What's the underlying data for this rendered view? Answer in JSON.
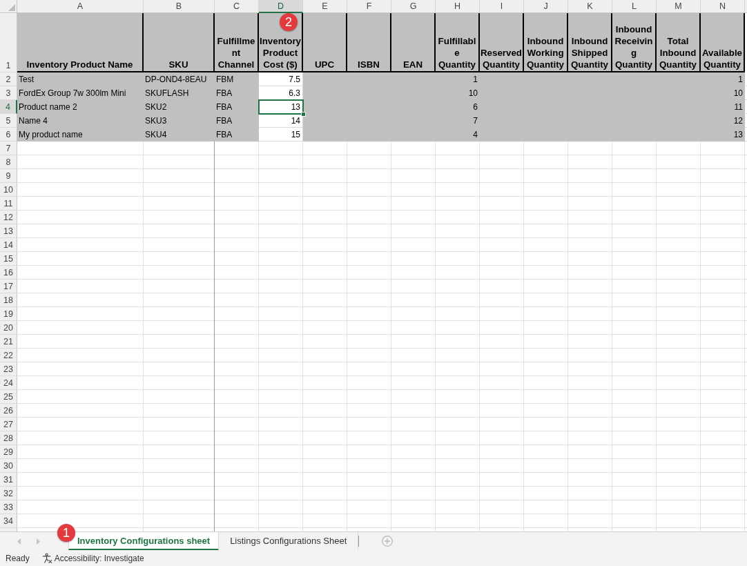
{
  "sheet": {
    "columns": [
      {
        "letter": "A",
        "selected": false
      },
      {
        "letter": "B",
        "selected": false
      },
      {
        "letter": "C",
        "selected": false
      },
      {
        "letter": "D",
        "selected": true,
        "callout": "2"
      },
      {
        "letter": "E",
        "selected": false
      },
      {
        "letter": "F",
        "selected": false
      },
      {
        "letter": "G",
        "selected": false
      },
      {
        "letter": "H",
        "selected": false
      },
      {
        "letter": "I",
        "selected": false
      },
      {
        "letter": "J",
        "selected": false
      },
      {
        "letter": "K",
        "selected": false
      },
      {
        "letter": "L",
        "selected": false
      },
      {
        "letter": "M",
        "selected": false
      },
      {
        "letter": "N",
        "selected": false
      }
    ],
    "rows": [
      {
        "number": "1",
        "selected": false,
        "cells": [
          {
            "kind": "heading",
            "value": "Inventory Product Name",
            "shaded": true
          },
          {
            "kind": "heading",
            "value": "SKU",
            "shaded": true
          },
          {
            "kind": "heading",
            "value": "Fulfillment Channel",
            "shaded": true
          },
          {
            "kind": "heading",
            "value": "Inventory Product Cost ($)",
            "shaded": true
          },
          {
            "kind": "heading",
            "value": "UPC",
            "shaded": true
          },
          {
            "kind": "heading",
            "value": "ISBN",
            "shaded": true
          },
          {
            "kind": "heading",
            "value": "EAN",
            "shaded": true
          },
          {
            "kind": "heading",
            "value": "Fulfillable Quantity",
            "shaded": true
          },
          {
            "kind": "heading",
            "value": "Reserved Quantity",
            "shaded": true
          },
          {
            "kind": "heading",
            "value": "Inbound Working Quantity",
            "shaded": true
          },
          {
            "kind": "heading",
            "value": "Inbound Shipped Quantity",
            "shaded": true
          },
          {
            "kind": "heading",
            "value": "Inbound Receiving Quantity",
            "shaded": true
          },
          {
            "kind": "heading",
            "value": "Total Inbound Quantity",
            "shaded": true
          },
          {
            "kind": "heading",
            "value": "Available Quantity",
            "shaded": true
          }
        ]
      },
      {
        "number": "2",
        "selected": false,
        "cells": [
          {
            "kind": "text",
            "value": "Test",
            "shaded": true
          },
          {
            "kind": "text",
            "value": "DP-OND4-8EAU",
            "shaded": true
          },
          {
            "kind": "text",
            "value": "FBM",
            "shaded": true
          },
          {
            "kind": "number",
            "value": "7.5",
            "shaded": false
          },
          null,
          null,
          null,
          {
            "kind": "number",
            "value": "1",
            "shaded": true
          },
          null,
          null,
          null,
          null,
          null,
          {
            "kind": "number",
            "value": "1",
            "shaded": true
          }
        ]
      },
      {
        "number": "3",
        "selected": false,
        "cells": [
          {
            "kind": "text",
            "value": "FordEx Group 7w 300lm Mini",
            "shaded": true
          },
          {
            "kind": "text",
            "value": "SKUFLASH",
            "shaded": true
          },
          {
            "kind": "text",
            "value": "FBA",
            "shaded": true
          },
          {
            "kind": "number",
            "value": "6.3",
            "shaded": false
          },
          null,
          null,
          null,
          {
            "kind": "number",
            "value": "10",
            "shaded": true
          },
          null,
          null,
          null,
          null,
          null,
          {
            "kind": "number",
            "value": "10",
            "shaded": true
          }
        ]
      },
      {
        "number": "4",
        "selected": true,
        "cells": [
          {
            "kind": "text",
            "value": "Product name 2",
            "shaded": true
          },
          {
            "kind": "text",
            "value": "SKU2",
            "shaded": true
          },
          {
            "kind": "text",
            "value": "FBA",
            "shaded": true
          },
          {
            "kind": "number",
            "value": "13",
            "shaded": false
          },
          null,
          null,
          null,
          {
            "kind": "number",
            "value": "6",
            "shaded": true
          },
          null,
          null,
          null,
          null,
          null,
          {
            "kind": "number",
            "value": "11",
            "shaded": true
          }
        ]
      },
      {
        "number": "5",
        "selected": false,
        "cells": [
          {
            "kind": "text",
            "value": "Name 4",
            "shaded": true
          },
          {
            "kind": "text",
            "value": "SKU3",
            "shaded": true
          },
          {
            "kind": "text",
            "value": "FBA",
            "shaded": true
          },
          {
            "kind": "number",
            "value": "14",
            "shaded": false
          },
          null,
          null,
          null,
          {
            "kind": "number",
            "value": "7",
            "shaded": true
          },
          null,
          null,
          null,
          null,
          null,
          {
            "kind": "number",
            "value": "12",
            "shaded": true
          }
        ]
      },
      {
        "number": "6",
        "selected": false,
        "cells": [
          {
            "kind": "text",
            "value": "My product name",
            "shaded": true
          },
          {
            "kind": "text",
            "value": "SKU4",
            "shaded": true
          },
          {
            "kind": "text",
            "value": "FBA",
            "shaded": true
          },
          {
            "kind": "number",
            "value": "15",
            "shaded": false
          },
          null,
          null,
          null,
          {
            "kind": "number",
            "value": "4",
            "shaded": true
          },
          null,
          null,
          null,
          null,
          null,
          {
            "kind": "number",
            "value": "13",
            "shaded": true
          }
        ]
      },
      {
        "number": "7",
        "selected": false
      },
      {
        "number": "8",
        "selected": false
      },
      {
        "number": "9",
        "selected": false
      },
      {
        "number": "10",
        "selected": false
      },
      {
        "number": "11",
        "selected": false
      },
      {
        "number": "12",
        "selected": false
      },
      {
        "number": "13",
        "selected": false
      },
      {
        "number": "14",
        "selected": false
      },
      {
        "number": "15",
        "selected": false
      },
      {
        "number": "16",
        "selected": false
      },
      {
        "number": "17",
        "selected": false
      },
      {
        "number": "18",
        "selected": false
      },
      {
        "number": "19",
        "selected": false
      },
      {
        "number": "20",
        "selected": false
      },
      {
        "number": "21",
        "selected": false
      },
      {
        "number": "22",
        "selected": false
      },
      {
        "number": "23",
        "selected": false
      },
      {
        "number": "24",
        "selected": false
      },
      {
        "number": "25",
        "selected": false
      },
      {
        "number": "26",
        "selected": false
      },
      {
        "number": "27",
        "selected": false
      },
      {
        "number": "28",
        "selected": false
      },
      {
        "number": "29",
        "selected": false
      },
      {
        "number": "30",
        "selected": false
      },
      {
        "number": "31",
        "selected": false
      },
      {
        "number": "32",
        "selected": false
      },
      {
        "number": "33",
        "selected": false
      },
      {
        "number": "34",
        "selected": false
      }
    ]
  },
  "sheet_tabs": [
    {
      "label": "Inventory Configurations sheet",
      "selected": true,
      "callout": "1"
    },
    {
      "label": "Listings Configurations Sheet",
      "selected": false
    }
  ],
  "status_bar": {
    "status": "Ready",
    "accessibility": "Accessibility: Investigate"
  }
}
